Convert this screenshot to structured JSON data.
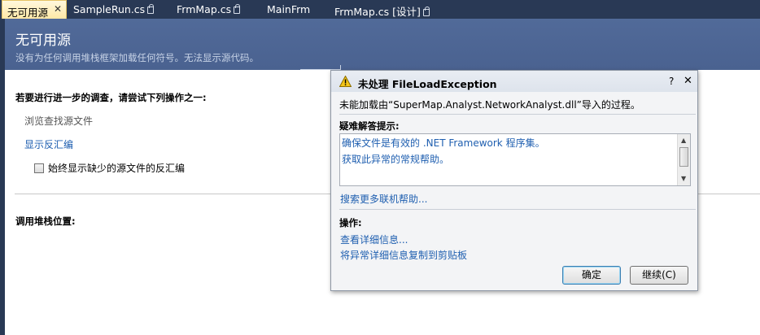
{
  "tabs": [
    {
      "label": "无可用源",
      "active": true,
      "close": "✕"
    },
    {
      "label": "SampleRun.cs",
      "locked": true
    },
    {
      "label": "FrmMap.cs",
      "locked": true
    },
    {
      "label": "MainFrm",
      "locked": false
    },
    {
      "label": "FrmMap.cs [设计]",
      "locked": true
    }
  ],
  "header": {
    "title": "无可用源",
    "subtitle": "没有为任何调用堆栈框架加载任何符号。无法显示源代码。"
  },
  "main": {
    "investigate_heading": "若要进行进一步的调查，请尝试下列操作之一:",
    "browse_source": "浏览查找源文件",
    "show_disassembly": "显示反汇编",
    "always_show_disassembly": "始终显示缺少的源文件的反汇编",
    "call_stack_heading": "调用堆栈位置:"
  },
  "dialog": {
    "title": "未处理 FileLoadException",
    "help_glyph": "?",
    "close_glyph": "✕",
    "message": "未能加载由“SuperMap.Analyst.NetworkAnalyst.dll”导入的过程。",
    "tips_heading": "疑难解答提示:",
    "tips": [
      "确保文件是有效的 .NET Framework 程序集。",
      "获取此异常的常规帮助。"
    ],
    "search_online": "搜索更多联机帮助...",
    "actions_heading": "操作:",
    "actions": [
      "查看详细信息...",
      "将异常详细信息复制到剪贴板"
    ],
    "ok_label": "确定",
    "continue_label": "继续(C)"
  },
  "colors": {
    "chrome_dark": "#293955",
    "header_blue": "#4a6290",
    "link_blue": "#1f5fb0",
    "active_tab": "#ffe8a6"
  },
  "icons": {
    "warning": "warning-triangle-icon",
    "lock": "lock-icon",
    "close": "close-icon"
  }
}
